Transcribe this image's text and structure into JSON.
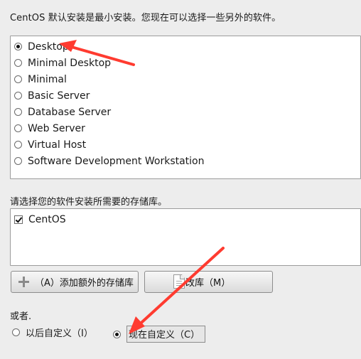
{
  "intro_text": "CentOS 默认安装是最小安装。您现在可以选择一些另外的软件。",
  "install_options": [
    {
      "label": "Desktop",
      "selected": true
    },
    {
      "label": "Minimal Desktop",
      "selected": false
    },
    {
      "label": "Minimal",
      "selected": false
    },
    {
      "label": "Basic Server",
      "selected": false
    },
    {
      "label": "Database Server",
      "selected": false
    },
    {
      "label": "Web Server",
      "selected": false
    },
    {
      "label": "Virtual Host",
      "selected": false
    },
    {
      "label": "Software Development Workstation",
      "selected": false
    }
  ],
  "repo_section_label": "请选择您的软件安装所需要的存储库。",
  "repositories": [
    {
      "label": "CentOS",
      "checked": true
    }
  ],
  "buttons": {
    "add_repo": "（A）添加额外的存储库",
    "edit_repo": "修改库（M）"
  },
  "or_label": "或者.",
  "customize_options": [
    {
      "label": "以后自定义（I）",
      "selected": false
    },
    {
      "label": "现在自定义（C）",
      "selected": true
    }
  ],
  "annotation_color": "#ff3b30"
}
